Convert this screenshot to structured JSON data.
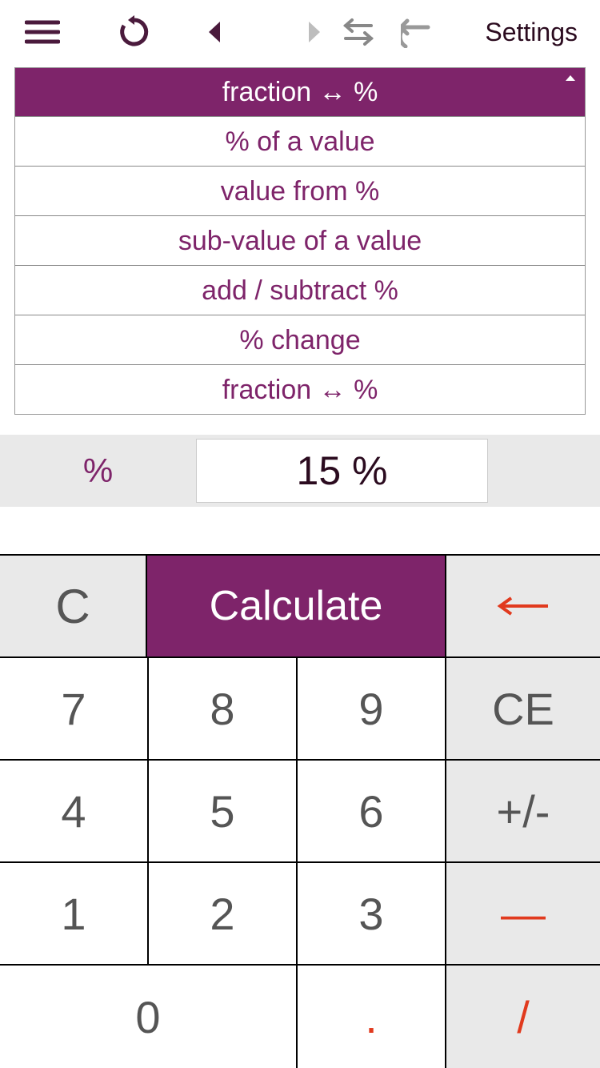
{
  "toolbar": {
    "settings_label": "Settings"
  },
  "modes": {
    "header": "fraction ↔ %",
    "items": [
      "% of a value",
      "value from %",
      "sub-value of a value",
      "add / subtract %",
      "% change",
      "fraction ↔ %"
    ]
  },
  "input": {
    "label": "%",
    "value": "15 %"
  },
  "keypad": {
    "clear": "C",
    "calculate": "Calculate",
    "backspace": "←",
    "k7": "7",
    "k8": "8",
    "k9": "9",
    "ce": "CE",
    "k4": "4",
    "k5": "5",
    "k6": "6",
    "sign": "+/-",
    "k1": "1",
    "k2": "2",
    "k3": "3",
    "minus": "—",
    "k0": "0",
    "dot": ".",
    "slash": "/"
  }
}
